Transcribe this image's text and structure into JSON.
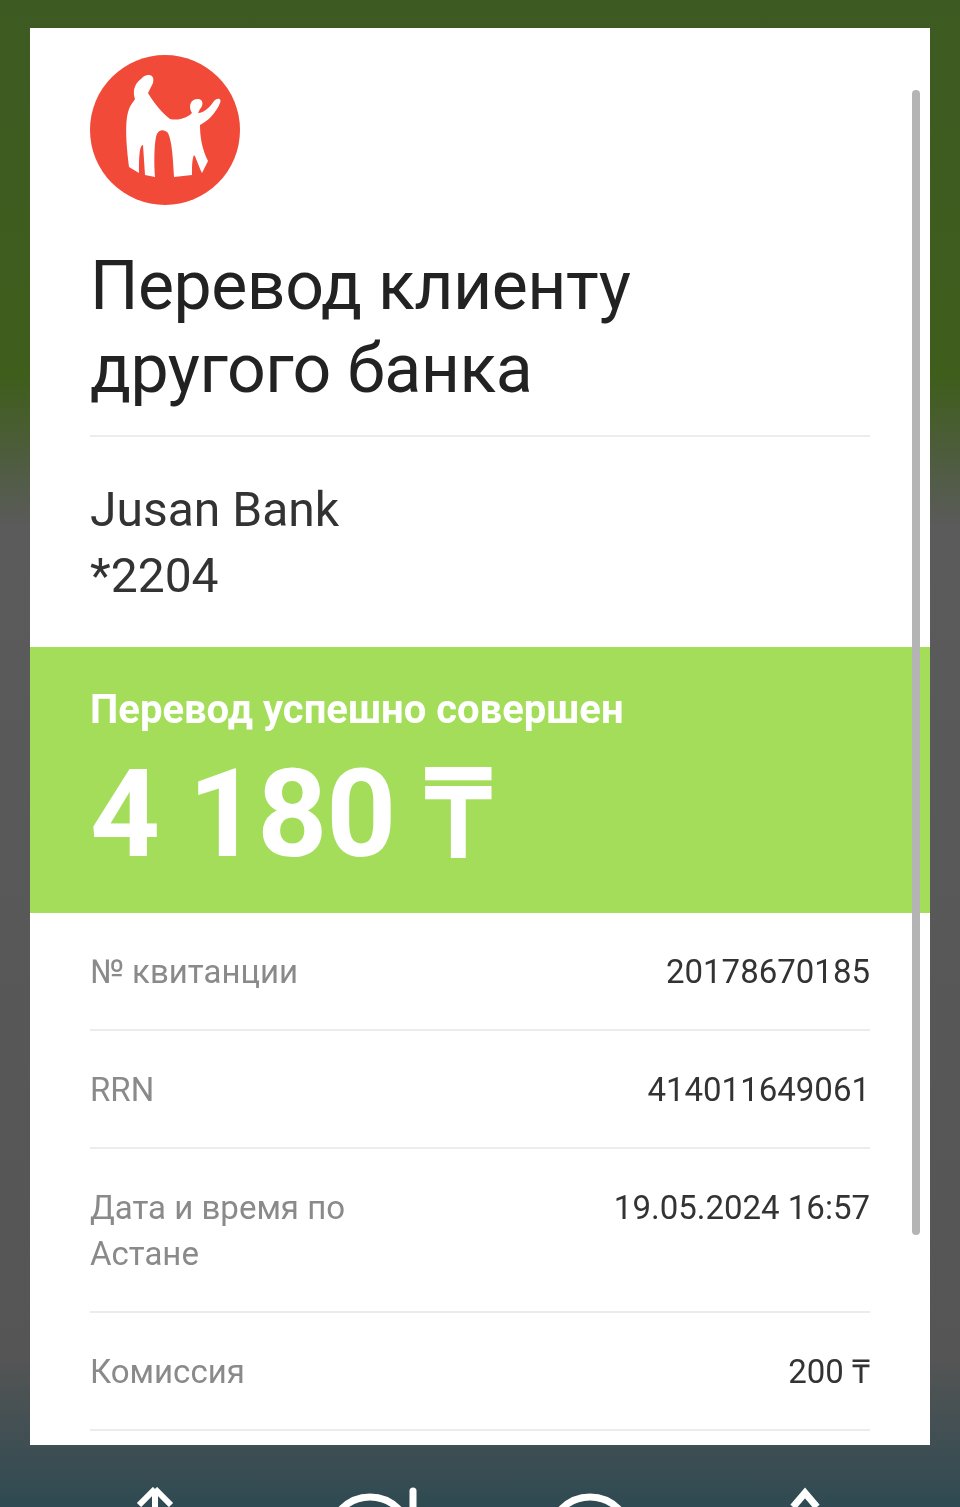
{
  "title": "Перевод клиенту другого банка",
  "recipient": {
    "bank": "Jusan Bank",
    "card": "*2204"
  },
  "status": {
    "message": "Перевод успешно совершен",
    "amount": "4 180 ₸"
  },
  "details": [
    {
      "label": "№ квитанции",
      "value": "20178670185"
    },
    {
      "label": "RRN",
      "value": "414011649061"
    },
    {
      "label": "Дата и время по Астане",
      "value": "19.05.2024 16:57"
    },
    {
      "label": "Комиссия",
      "value": "200 ₸"
    }
  ]
}
